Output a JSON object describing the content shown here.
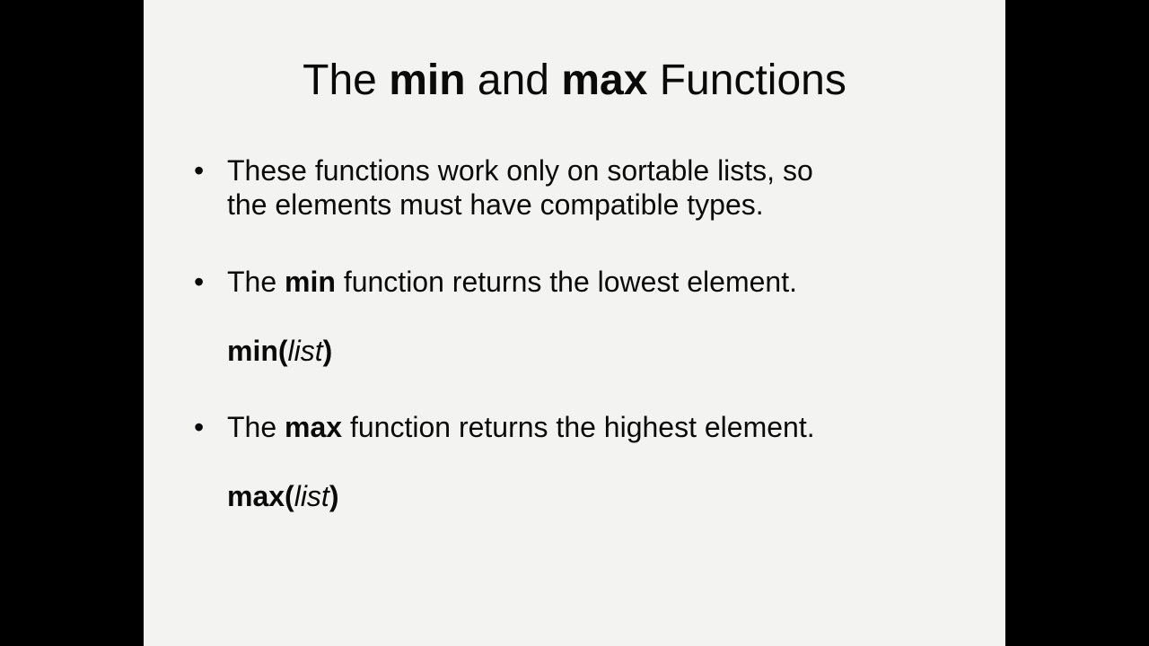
{
  "slide": {
    "title": {
      "prefix": "The ",
      "word1": "min",
      "middle": " and ",
      "word2": "max",
      "suffix": " Functions"
    },
    "bullet_char": "•",
    "bullets": [
      {
        "line1": "These functions work only on sortable lists, so",
        "line2": "the elements must have compatible types."
      },
      {
        "prefix": "The ",
        "bold": "min",
        "suffix": " function returns the lowest element."
      },
      {
        "prefix": "The ",
        "bold": "max",
        "suffix": " function returns the highest element."
      }
    ],
    "syntax": [
      {
        "func": "min(",
        "arg": "list",
        "close": ")"
      },
      {
        "func": "max(",
        "arg": "list",
        "close": ")"
      }
    ]
  },
  "colors": {
    "letterbox": "#000000",
    "slide_background": "#f3f4f1",
    "text": "#0a0a0a"
  }
}
